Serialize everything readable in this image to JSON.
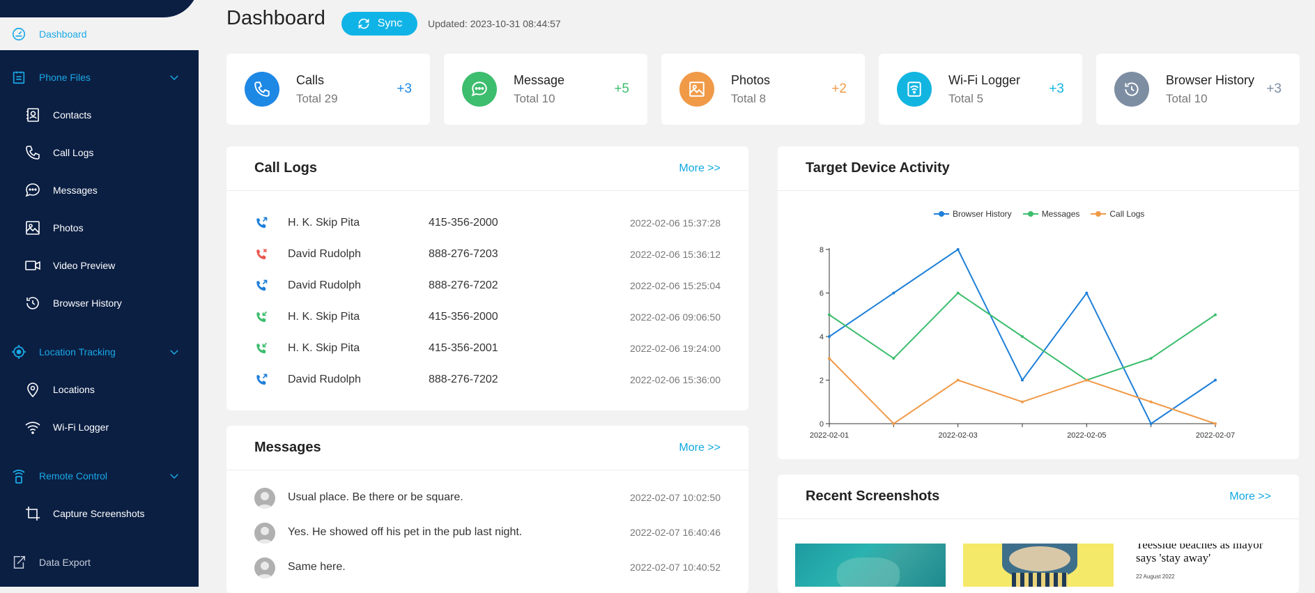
{
  "sidebar": {
    "dashboard": "Dashboard",
    "sections": [
      {
        "label": "Phone Files"
      },
      {
        "label": "Location Tracking"
      },
      {
        "label": "Remote Control"
      }
    ],
    "items": [
      {
        "label": "Contacts"
      },
      {
        "label": "Call Logs"
      },
      {
        "label": "Messages"
      },
      {
        "label": "Photos"
      },
      {
        "label": "Video Preview"
      },
      {
        "label": "Browser History"
      },
      {
        "label": "Locations"
      },
      {
        "label": "Wi-Fi Logger"
      },
      {
        "label": "Capture Screenshots"
      }
    ],
    "data_export": "Data Export"
  },
  "header": {
    "title": "Dashboard",
    "sync_label": "Sync",
    "updated": "Updated: 2023-10-31 08:44:57"
  },
  "stats": [
    {
      "name": "Calls",
      "total": "Total 29",
      "delta": "+3",
      "color": "#1e88e5",
      "icon": "phone-icon"
    },
    {
      "name": "Message",
      "total": "Total 10",
      "delta": "+5",
      "color": "#3dbd6e",
      "icon": "chat-icon"
    },
    {
      "name": "Photos",
      "total": "Total 8",
      "delta": "+2",
      "color": "#f09a48",
      "icon": "image-icon"
    },
    {
      "name": "Wi-Fi Logger",
      "total": "Total 5",
      "delta": "+3",
      "color": "#12b5e0",
      "icon": "wifi-icon"
    },
    {
      "name": "Browser History",
      "total": "Total 10",
      "delta": "+3",
      "color": "#7d8ea3",
      "icon": "history-icon"
    }
  ],
  "call_logs": {
    "title": "Call Logs",
    "more": "More >>",
    "rows": [
      {
        "type": "outgoing",
        "name": "H. K. Skip Pita",
        "number": "415-356-2000",
        "time": "2022-02-06 15:37:28"
      },
      {
        "type": "missed",
        "name": "David Rudolph",
        "number": "888-276-7203",
        "time": "2022-02-06 15:36:12"
      },
      {
        "type": "outgoing",
        "name": "David Rudolph",
        "number": "888-276-7202",
        "time": "2022-02-06 15:25:04"
      },
      {
        "type": "incoming",
        "name": "H. K. Skip Pita",
        "number": "415-356-2000",
        "time": "2022-02-06 09:06:50"
      },
      {
        "type": "incoming",
        "name": "H. K. Skip Pita",
        "number": "415-356-2001",
        "time": "2022-02-06 19:24:00"
      },
      {
        "type": "outgoing",
        "name": "David Rudolph",
        "number": "888-276-7202",
        "time": "2022-02-06 15:36:00"
      }
    ]
  },
  "messages": {
    "title": "Messages",
    "more": "More >>",
    "rows": [
      {
        "text": "Usual place. Be there or be square.",
        "time": "2022-02-07 10:02:50"
      },
      {
        "text": "Yes. He showed off his pet in the pub last night.",
        "time": "2022-02-07 16:40:46"
      },
      {
        "text": "Same here.",
        "time": "2022-02-07 10:40:52"
      }
    ]
  },
  "activity": {
    "title": "Target Device Activity"
  },
  "chart_data": {
    "type": "line",
    "x": [
      "2022-02-01",
      "2022-02-02",
      "2022-02-03",
      "2022-02-04",
      "2022-02-05",
      "2022-02-06",
      "2022-02-07"
    ],
    "xticks": [
      "2022-02-01",
      "2022-02-03",
      "2022-02-05",
      "2022-02-07"
    ],
    "yticks": [
      0,
      2,
      4,
      6,
      8
    ],
    "ylim": [
      0,
      8
    ],
    "legend_position": "top-center",
    "series": [
      {
        "name": "Browser History",
        "color": "#1e7fd8",
        "values": [
          4,
          6,
          8,
          2,
          6,
          0,
          2
        ]
      },
      {
        "name": "Messages",
        "color": "#3dbd6e",
        "values": [
          5,
          3,
          6,
          4,
          2,
          3,
          5
        ]
      },
      {
        "name": "Call Logs",
        "color": "#f09a48",
        "values": [
          3,
          0,
          2,
          1,
          2,
          1,
          0
        ]
      }
    ]
  },
  "screenshots": {
    "title": "Recent Screenshots",
    "more": "More >>",
    "headline": "Teesside beaches as mayor says 'stay away'",
    "date": "22 August 2022"
  }
}
